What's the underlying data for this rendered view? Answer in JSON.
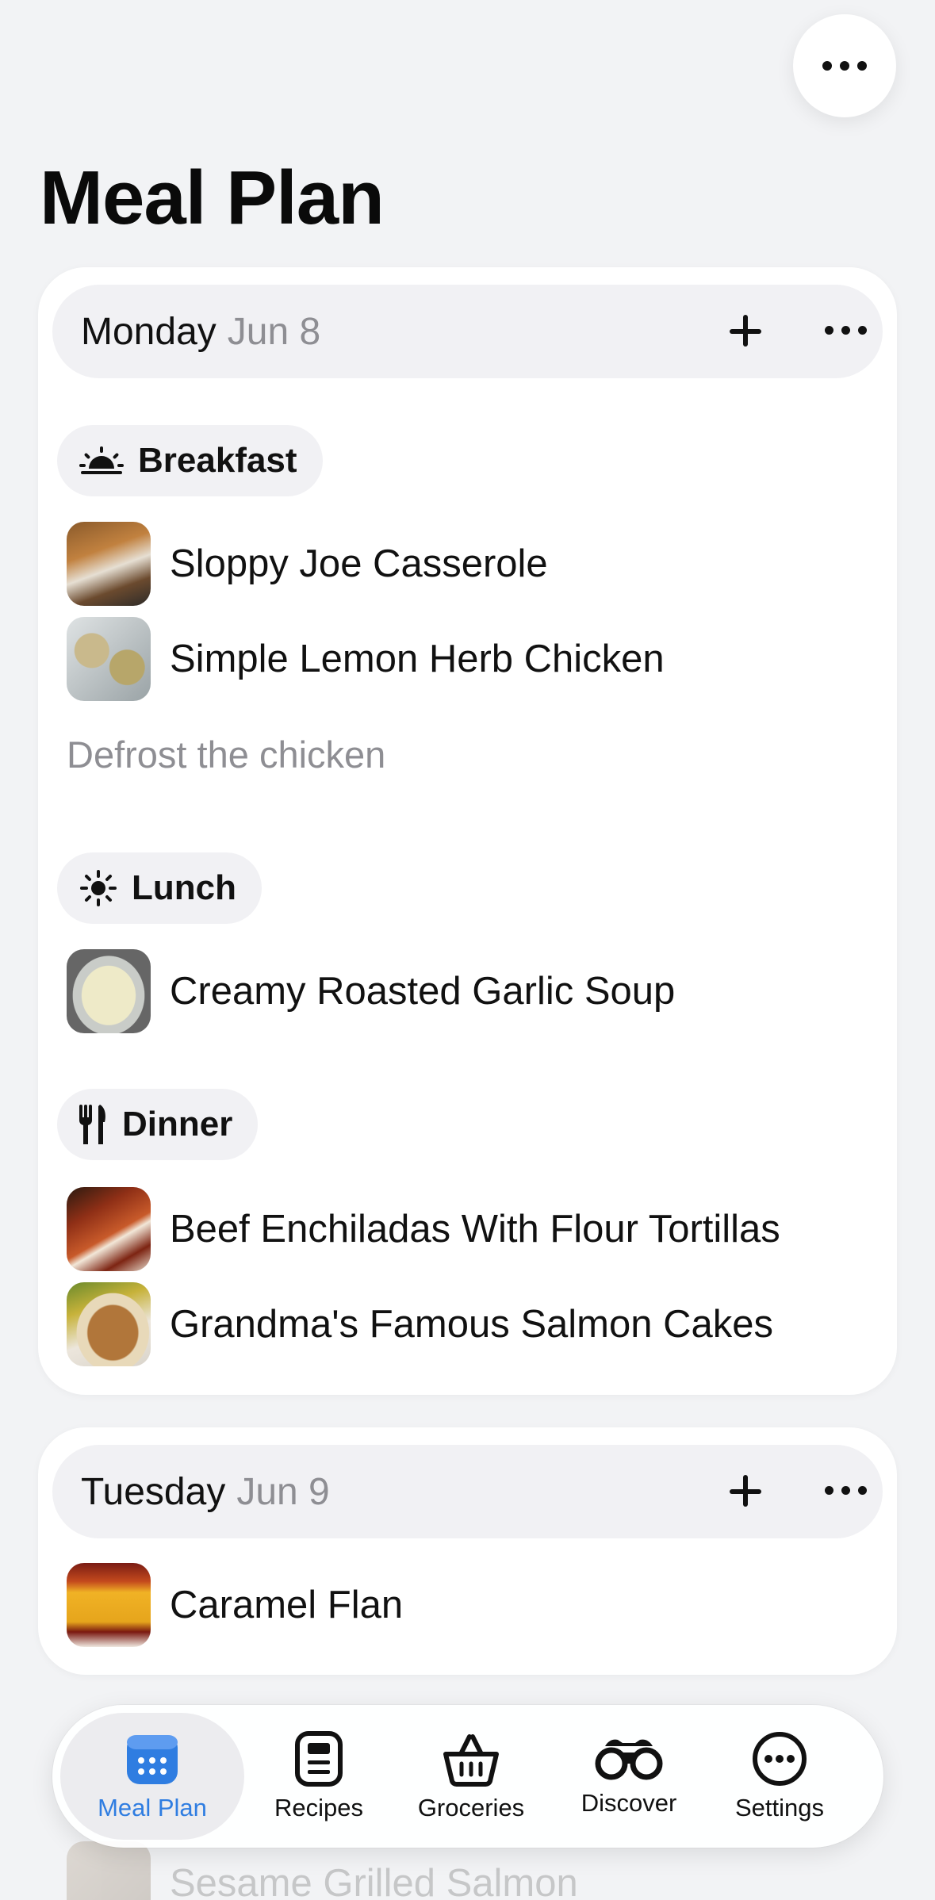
{
  "page": {
    "title": "Meal Plan"
  },
  "header": {
    "more_icon": "more-horizontal-icon"
  },
  "days": [
    {
      "name": "Monday",
      "date": "Jun 8",
      "meals": [
        {
          "label": "Breakfast",
          "icon": "sunrise-icon",
          "recipes": [
            "Sloppy Joe Casserole",
            "Simple Lemon Herb Chicken"
          ],
          "note": "Defrost the chicken"
        },
        {
          "label": "Lunch",
          "icon": "sun-icon",
          "recipes": [
            "Creamy Roasted Garlic Soup"
          ]
        },
        {
          "label": "Dinner",
          "icon": "fork-knife-icon",
          "recipes": [
            "Beef Enchiladas With Flour Tortillas",
            "Grandma's Famous Salmon Cakes"
          ]
        }
      ]
    },
    {
      "name": "Tuesday",
      "date": "Jun 9",
      "recipes": [
        "Caramel Flan"
      ]
    }
  ],
  "partially_visible": {
    "recipe": "Sesame Grilled Salmon"
  },
  "tabbar": {
    "tabs": [
      {
        "label": "Meal Plan",
        "icon": "calendar-icon",
        "active": true
      },
      {
        "label": "Recipes",
        "icon": "recipe-card-icon",
        "active": false
      },
      {
        "label": "Groceries",
        "icon": "basket-icon",
        "active": false
      },
      {
        "label": "Discover",
        "icon": "binoculars-icon",
        "active": false
      },
      {
        "label": "Settings",
        "icon": "more-circle-icon",
        "active": false
      }
    ]
  },
  "colors": {
    "background": "#f2f3f5",
    "accent": "#2f7de1",
    "secondary_text": "#8e8e93",
    "pill_background": "#f1f1f4"
  }
}
